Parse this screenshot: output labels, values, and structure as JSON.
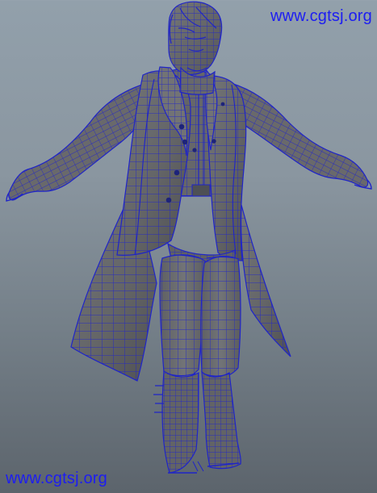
{
  "viewport": {
    "background_top": "#92a0ab",
    "background_bottom": "#5c646c",
    "wire_color": "#1f24c8",
    "mesh_fill": "#626366",
    "mesh_fill_light": "#707275",
    "button_color": "#1d237a"
  },
  "watermarks": {
    "top": "www.cgtsj.org",
    "bottom": "www.cgtsj.org"
  },
  "model": {
    "icon": "character-mesh-icon"
  }
}
